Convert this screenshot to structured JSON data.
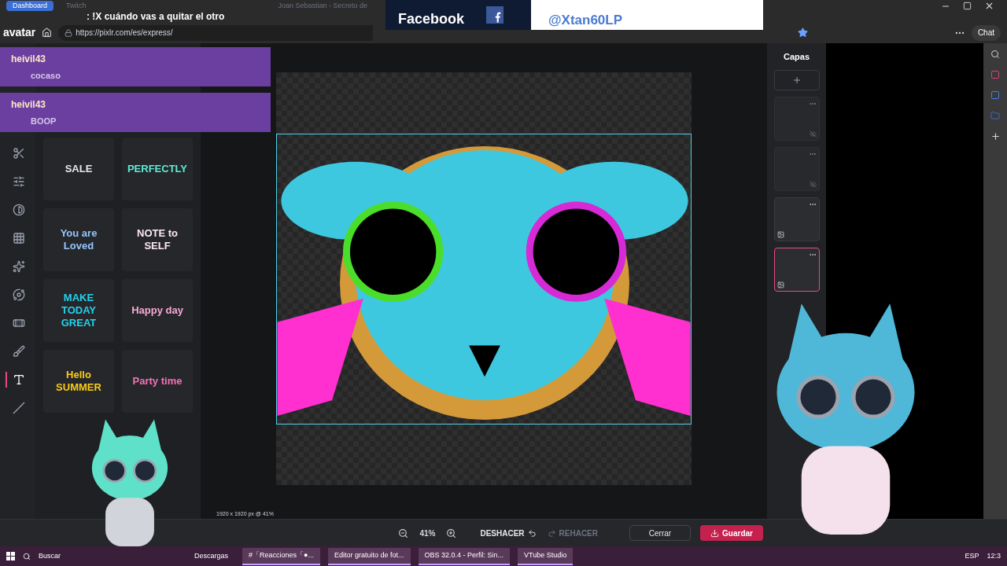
{
  "browser": {
    "tabs": [
      {
        "label": "Dashboard",
        "selected": true
      },
      {
        "label": "Twitch",
        "selected": false
      },
      {
        "label": "Joan Sebastian - Secreto de",
        "selected": false
      }
    ],
    "chat_line": ": !X cuándo vas a quitar el otro",
    "overlay_word": "avatar",
    "url": "https://pixlr.com/es/express/",
    "chat_button": "Chat"
  },
  "facebook_banner": {
    "title": "Facebook",
    "handle": "@Xtan60LP"
  },
  "chat_messages": [
    {
      "user": "heivil43",
      "text": "cocaso"
    },
    {
      "user": "heivil43",
      "text": "BOOP"
    }
  ],
  "tools": [
    {
      "selected": false
    },
    {
      "selected": false
    },
    {
      "selected": false
    },
    {
      "selected": false
    },
    {
      "selected": false
    },
    {
      "selected": false
    },
    {
      "selected": false
    },
    {
      "selected": false
    },
    {
      "selected": true
    },
    {
      "selected": false
    }
  ],
  "stickers": [
    {
      "text": "SALE",
      "color": "#e5e7eb"
    },
    {
      "text": "PERFECTLY",
      "color": "#5eead4"
    },
    {
      "text": "You are Loved",
      "color": "#93c5fd"
    },
    {
      "text": "NOTE to SELF",
      "color": "#fce7f3"
    },
    {
      "text": "MAKE TODAY GREAT",
      "color": "#22d3ee"
    },
    {
      "text": "Happy day",
      "color": "#f9a8d4"
    },
    {
      "text": "Hello SUMMER",
      "color": "#facc15"
    },
    {
      "text": "Party time",
      "color": "#f472b6"
    }
  ],
  "canvas": {
    "size_label": "1920 x 1920 px @ 41%"
  },
  "layers": {
    "title": "Capas",
    "items": [
      {
        "hidden": true,
        "selected": false
      },
      {
        "hidden": true,
        "selected": false
      },
      {
        "hidden": false,
        "selected": false
      },
      {
        "hidden": false,
        "selected": true
      }
    ]
  },
  "bottom_bar": {
    "zoom": "41%",
    "undo": {
      "label": "DESHACER",
      "disabled": false
    },
    "redo": {
      "label": "REHACER",
      "disabled": true
    },
    "close": "Cerrar",
    "save": "Guardar"
  },
  "taskbar": {
    "search": "Buscar",
    "apps": [
      {
        "label": "Descargas",
        "active": false
      },
      {
        "label": "#「Reacciones「●...",
        "active": true
      },
      {
        "label": "Editor gratuito de fot...",
        "active": true
      },
      {
        "label": "OBS 32.0.4 - Perfil: Sin...",
        "active": true
      },
      {
        "label": "VTube Studio",
        "active": true
      }
    ],
    "language": "ESP",
    "time": "12:3"
  }
}
